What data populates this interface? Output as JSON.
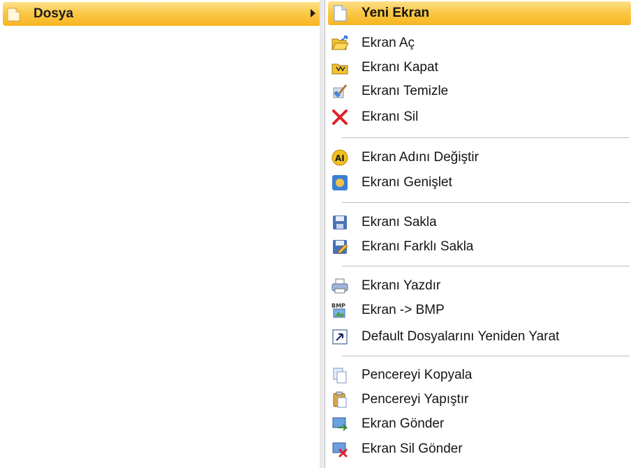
{
  "left_menu": {
    "item": {
      "label": "Dosya",
      "icon": "folder-icon",
      "has_submenu": true
    }
  },
  "submenu": {
    "items": [
      {
        "label": "Yeni Ekran",
        "icon": "new-document-icon",
        "active": true
      },
      {
        "label": "Ekran Aç",
        "icon": "open-folder-icon"
      },
      {
        "label": "Ekranı Kapat",
        "icon": "close-folder-icon"
      },
      {
        "label": "Ekranı Temizle",
        "icon": "clean-icon"
      },
      {
        "label": "Ekranı Sil",
        "icon": "delete-x-icon"
      },
      {
        "label": "Ekran Adını Değiştir",
        "icon": "rename-icon"
      },
      {
        "label": "Ekranı Genişlet",
        "icon": "expand-icon"
      },
      {
        "label": "Ekranı Sakla",
        "icon": "save-icon"
      },
      {
        "label": "Ekranı Farklı Sakla",
        "icon": "save-as-icon"
      },
      {
        "label": "Ekranı Yazdır",
        "icon": "printer-icon"
      },
      {
        "label": "Ekran -> BMP",
        "icon": "bmp-export-icon"
      },
      {
        "label": "Default Dosyalarını Yeniden Yarat",
        "icon": "shortcut-arrow-icon"
      },
      {
        "label": "Pencereyi Kopyala",
        "icon": "copy-icon"
      },
      {
        "label": "Pencereyi Yapıştır",
        "icon": "paste-icon"
      },
      {
        "label": "Ekran Gönder",
        "icon": "send-icon"
      },
      {
        "label": "Ekran Sil Gönder",
        "icon": "send-delete-icon"
      }
    ]
  },
  "colors": {
    "highlight_top": "#fde08a",
    "highlight_bottom": "#f6b51f",
    "separator": "#bdbdbd"
  }
}
